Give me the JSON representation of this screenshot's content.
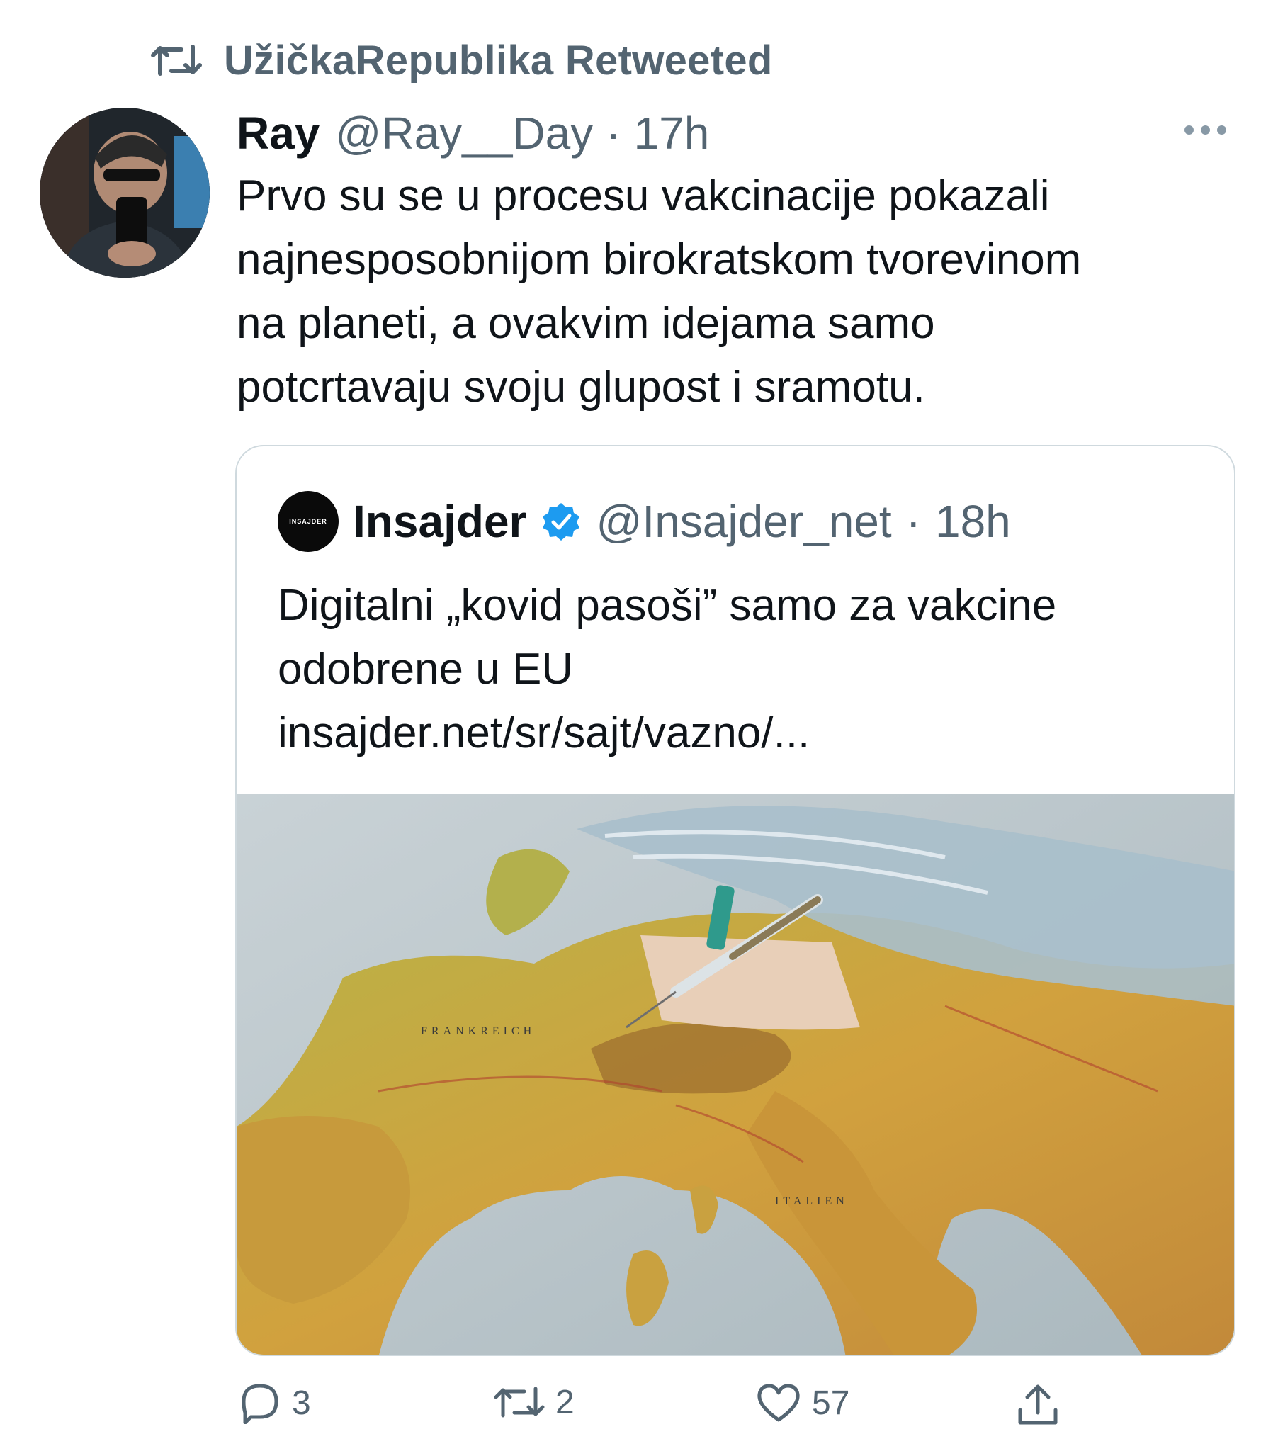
{
  "retweet": {
    "label": "UžičkaRepublika Retweeted",
    "icon": "retweet-icon"
  },
  "tweet": {
    "name": "Ray",
    "handle": "@Ray__Day",
    "separator": "·",
    "time": "17h",
    "text_lines": [
      "Prvo su se u procesu vakcinacije pokazali",
      "najnesposobnijom birokratskom tvorevinom",
      "na planeti, a ovakvim idejama samo",
      "potcrtavaju svoju glupost i sramotu."
    ]
  },
  "quote": {
    "avatar_text": "INSAJDER",
    "name": "Insajder",
    "verified": true,
    "handle": "@Insajder_net",
    "separator": "·",
    "time": "18h",
    "text_lines": [
      "Digitalni „kovid pasoši” samo za vakcine",
      "odobrene u EU"
    ],
    "link": "insajder.net/sr/sajt/vazno/..."
  },
  "actions": {
    "replies": "3",
    "retweets": "2",
    "likes": "57"
  },
  "colors": {
    "muted": "#536471",
    "verified": "#1d9bf0",
    "border": "#cfd9de"
  }
}
